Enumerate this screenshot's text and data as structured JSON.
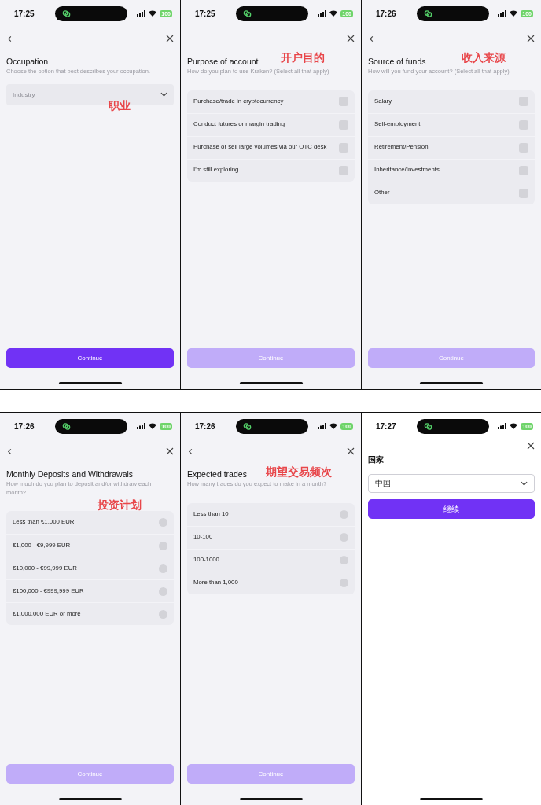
{
  "screens": [
    {
      "kind": "select",
      "time": "17:25",
      "battery": "100",
      "back": true,
      "title": "Occupation",
      "subtitle": "Choose the option that best describes your occupation.",
      "annotation": "职业",
      "field": {
        "placeholder": "Industry"
      },
      "button": {
        "label": "Continue",
        "disabled": false
      }
    },
    {
      "kind": "checklist",
      "time": "17:25",
      "battery": "100",
      "back": false,
      "title": "Purpose of account",
      "subtitle": "How do you plan to use Kraken? (Select all that apply)",
      "annotation": "开户目的",
      "options": [
        {
          "label": "Purchase/trade in cryptocurrency",
          "checked": false
        },
        {
          "label": "Conduct futures or margin trading",
          "checked": false
        },
        {
          "label": "Purchase or sell large volumes via our OTC desk",
          "checked": false
        },
        {
          "label": "I'm still exploring",
          "checked": false
        }
      ],
      "button": {
        "label": "Continue",
        "disabled": true
      }
    },
    {
      "kind": "checklist",
      "time": "17:26",
      "battery": "100",
      "back": true,
      "title": "Source of funds",
      "subtitle": "How will you fund your account? (Select all that apply)",
      "annotation": "收入来源",
      "options": [
        {
          "label": "Salary",
          "checked": false
        },
        {
          "label": "Self-employment",
          "checked": false
        },
        {
          "label": "Retirement/Pension",
          "checked": false
        },
        {
          "label": "Inheritance/Investments",
          "checked": false
        },
        {
          "label": "Other",
          "checked": false
        }
      ],
      "button": {
        "label": "Continue",
        "disabled": true
      }
    },
    {
      "kind": "radiolist",
      "time": "17:26",
      "battery": "100",
      "back": true,
      "title": "Monthly Deposits and Withdrawals",
      "subtitle": "How much do you plan to deposit and/or withdraw each month?",
      "annotation": "投资计划",
      "options": [
        {
          "label": "Less than €1,000 EUR",
          "selected": false
        },
        {
          "label": "€1,000 - €9,999 EUR",
          "selected": false
        },
        {
          "label": "€10,000 - €99,999 EUR",
          "selected": false
        },
        {
          "label": "€100,000 - €999,999 EUR",
          "selected": false
        },
        {
          "label": "€1,000,000 EUR or more",
          "selected": false
        }
      ],
      "button": {
        "label": "Continue",
        "disabled": true
      }
    },
    {
      "kind": "radiolist",
      "time": "17:26",
      "battery": "100",
      "back": true,
      "title": "Expected trades",
      "subtitle": "How many trades do you expect to make in a month?",
      "annotation": "期望交易频次",
      "options": [
        {
          "label": "Less than 10",
          "selected": false
        },
        {
          "label": "10-100",
          "selected": false
        },
        {
          "label": "100-1000",
          "selected": false
        },
        {
          "label": "More than 1,000",
          "selected": false
        }
      ],
      "button": {
        "label": "Continue",
        "disabled": true
      }
    },
    {
      "kind": "country",
      "time": "17:27",
      "battery": "100",
      "back": false,
      "title": "国家",
      "field": {
        "value": "中国"
      },
      "button": {
        "label": "继续",
        "disabled": false
      }
    }
  ]
}
